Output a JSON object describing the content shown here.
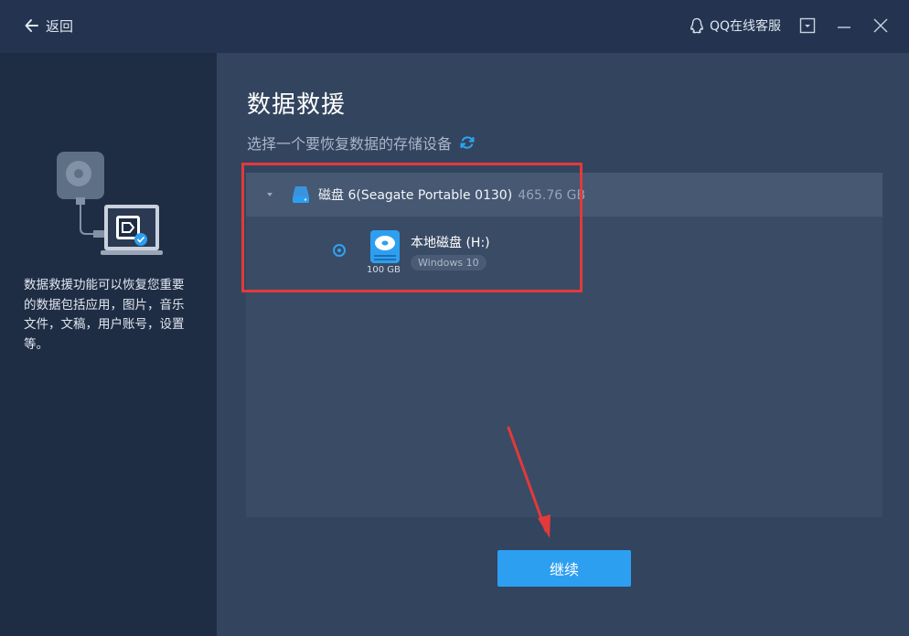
{
  "header": {
    "back_label": "返回",
    "support_label": "QQ在线客服"
  },
  "sidebar": {
    "description": "数据救援功能可以恢复您重要的数据包括应用，图片，音乐文件，文稿，用户账号，设置等。"
  },
  "main": {
    "title": "数据救援",
    "subtitle": "选择一个要恢复数据的存储设备",
    "disk": {
      "name": "磁盘 6(Seagate Portable 0130)",
      "size": "465.76 GB",
      "expanded": true
    },
    "partition": {
      "name": "本地磁盘 (H:)",
      "os": "Windows 10",
      "size": "100 GB",
      "selected": true
    },
    "continue_label": "继续"
  },
  "colors": {
    "accent": "#2d9ff1",
    "annotation": "#e23a3a",
    "sidebar_bg": "#1f2d44",
    "main_bg": "#33445f"
  },
  "icons": [
    "back-arrow-icon",
    "qq-penguin-icon",
    "dropdown-menu-icon",
    "minimize-icon",
    "close-icon",
    "refresh-icon",
    "caret-down-icon",
    "disk-icon",
    "partition-icon",
    "radio-button"
  ]
}
